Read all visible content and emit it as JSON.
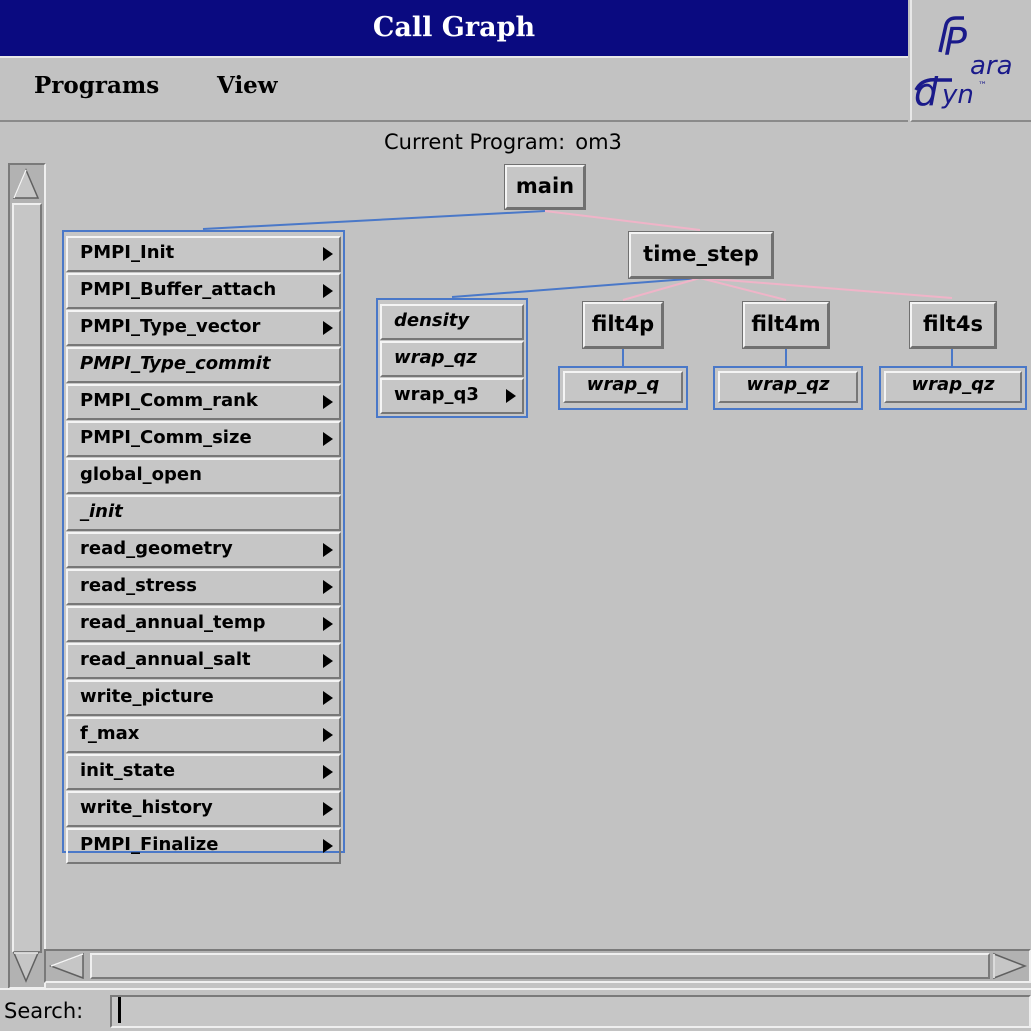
{
  "window": {
    "title": "Call Graph"
  },
  "menu": {
    "programs": "Programs",
    "view": "View"
  },
  "logo": {
    "text_top": "Para",
    "text_bottom": "dyn",
    "tm": "™"
  },
  "current_program": {
    "label": "Current Program:",
    "value": "om3"
  },
  "graph": {
    "root": "main",
    "time_step": "time_step",
    "main_children": [
      {
        "label": "PMPI_Init",
        "italic": false,
        "expandable": true
      },
      {
        "label": "PMPI_Buffer_attach",
        "italic": false,
        "expandable": true
      },
      {
        "label": "PMPI_Type_vector",
        "italic": false,
        "expandable": true
      },
      {
        "label": "PMPI_Type_commit",
        "italic": true,
        "expandable": false
      },
      {
        "label": "PMPI_Comm_rank",
        "italic": false,
        "expandable": true
      },
      {
        "label": "PMPI_Comm_size",
        "italic": false,
        "expandable": true
      },
      {
        "label": "global_open",
        "italic": false,
        "expandable": false
      },
      {
        "label": "_init",
        "italic": true,
        "expandable": false
      },
      {
        "label": "read_geometry",
        "italic": false,
        "expandable": true
      },
      {
        "label": "read_stress",
        "italic": false,
        "expandable": true
      },
      {
        "label": "read_annual_temp",
        "italic": false,
        "expandable": true
      },
      {
        "label": "read_annual_salt",
        "italic": false,
        "expandable": true
      },
      {
        "label": "write_picture",
        "italic": false,
        "expandable": true
      },
      {
        "label": "f_max",
        "italic": false,
        "expandable": true
      },
      {
        "label": "init_state",
        "italic": false,
        "expandable": true
      },
      {
        "label": "write_history",
        "italic": false,
        "expandable": true
      },
      {
        "label": "PMPI_Finalize",
        "italic": false,
        "expandable": true
      }
    ],
    "time_step_group": [
      {
        "label": "density",
        "italic": true,
        "expandable": false
      },
      {
        "label": "wrap_qz",
        "italic": true,
        "expandable": false
      },
      {
        "label": "wrap_q3",
        "italic": false,
        "expandable": true
      }
    ],
    "filters": [
      {
        "label": "filt4p",
        "child": "wrap_q"
      },
      {
        "label": "filt4m",
        "child": "wrap_qz"
      },
      {
        "label": "filt4s",
        "child": "wrap_qz"
      }
    ]
  },
  "search": {
    "label": "Search:",
    "value": ""
  },
  "colors": {
    "titlebar": "#0a0a80",
    "edge_blue": "#4a78c8",
    "edge_pink": "#f0b4c8",
    "background": "#c2c2c2"
  }
}
